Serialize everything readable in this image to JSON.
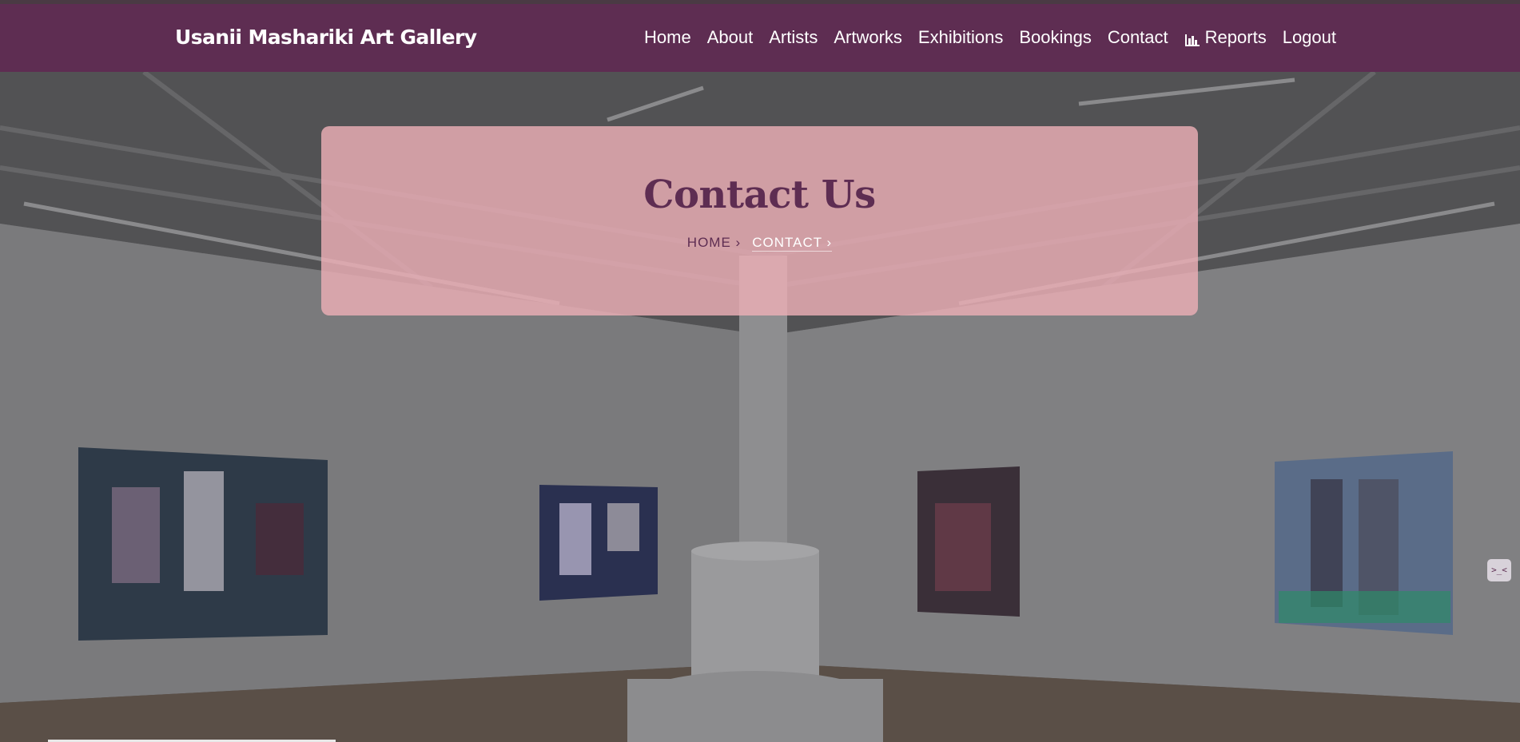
{
  "navbar": {
    "brand": "Usanii Mashariki Art Gallery",
    "menu": [
      {
        "label": "Home",
        "icon": ""
      },
      {
        "label": "About",
        "icon": ""
      },
      {
        "label": "Artists",
        "icon": ""
      },
      {
        "label": "Artworks",
        "icon": ""
      },
      {
        "label": "Exhibitions",
        "icon": ""
      },
      {
        "label": "Bookings",
        "icon": ""
      },
      {
        "label": "Contact",
        "icon": ""
      },
      {
        "label": "Reports",
        "icon": "bar-chart-icon"
      },
      {
        "label": "Logout",
        "icon": ""
      }
    ]
  },
  "hero": {
    "title": "Contact Us",
    "breadcrumb": {
      "home": "HOME",
      "current": "CONTACT",
      "separator": "›"
    }
  },
  "widget": {
    "label": ">_<"
  },
  "colors": {
    "brand": "#5e2d52",
    "card": "#ecaeb6",
    "text_light": "#ffffff"
  }
}
